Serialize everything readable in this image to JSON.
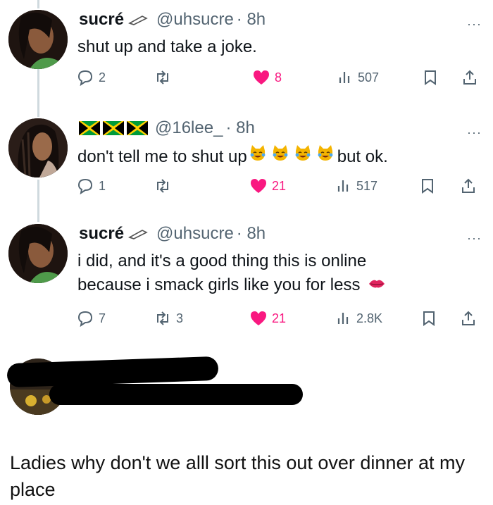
{
  "tweets": [
    {
      "name": "sucré",
      "handle": "@uhsucre",
      "time": "· 8h",
      "text": "shut up and take a joke.",
      "replies": "2",
      "retweets": "",
      "likes": "8",
      "views": "507"
    },
    {
      "name": "",
      "handle": "@16lee_",
      "time": "· 8h",
      "text_before": "don't tell me to shut up",
      "text_after": "but ok.",
      "replies": "1",
      "retweets": "",
      "likes": "21",
      "views": "517"
    },
    {
      "name": "sucré",
      "handle": "@uhsucre",
      "time": "· 8h",
      "text_line1": "i did, and it's a good thing this is online",
      "text_line2": "because i smack girls like you for less",
      "replies": "7",
      "retweets": "3",
      "likes": "21",
      "views": "2.8K"
    }
  ],
  "more_glyph": "···",
  "caption": "Ladies why don't we alll sort this out over dinner at my place",
  "colors": {
    "like": "#f91880",
    "muted": "#536471",
    "text": "#0f1419"
  }
}
